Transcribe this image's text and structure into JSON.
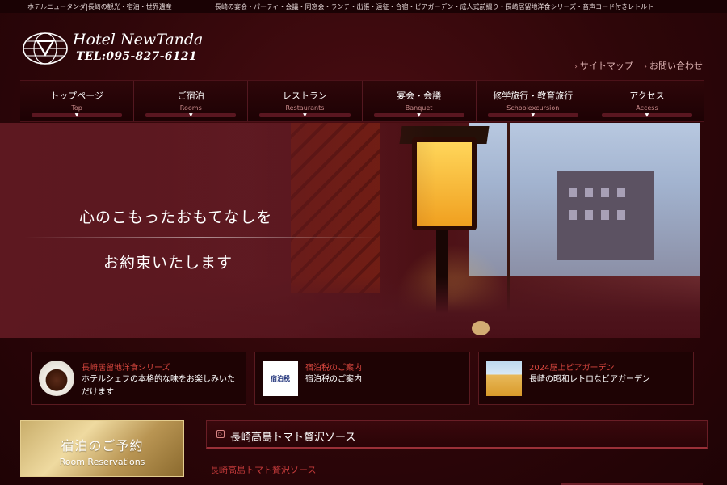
{
  "topbar": {
    "left": "ホテルニュータンダ|長崎の観光・宿泊・世界遺産",
    "right": "長崎の宴会・パーティ・会議・同窓会・ランチ・出張・遠征・合宿・ビアガーデン・成人式前撮り・長崎居留地洋食シリーズ・音声コード付きレトルト"
  },
  "logo": {
    "name": "Hotel NewTanda",
    "tel": "TEL:095-827-6121"
  },
  "utility": {
    "sitemap": "サイトマップ",
    "contact": "お問い合わせ"
  },
  "nav": [
    {
      "ja": "トップページ",
      "en": "Top"
    },
    {
      "ja": "ご宿泊",
      "en": "Rooms"
    },
    {
      "ja": "レストラン",
      "en": "Restaurants"
    },
    {
      "ja": "宴会・会議",
      "en": "Banquet"
    },
    {
      "ja": "修学旅行・教育旅行",
      "en": "Schoolexcursion"
    },
    {
      "ja": "アクセス",
      "en": "Access"
    }
  ],
  "hero": {
    "line1": "心のこもったおもてなしを",
    "line2": "お約束いたします"
  },
  "cards": [
    {
      "title": "長崎居留地洋食シリーズ",
      "desc": "ホテルシェフの本格的な味をお楽しみいただけます",
      "icon": "food-plate-icon"
    },
    {
      "title": "宿泊税のご案内",
      "desc": "宿泊税のご案内",
      "thumb_text": "宿泊税",
      "icon": "tax-label-icon"
    },
    {
      "title": "2024屋上ビアガーデン",
      "desc": "長崎の昭和レトロなビアガーデン",
      "icon": "beer-icon"
    }
  ],
  "reserve": {
    "ja": "宿泊のご予約",
    "en": "Room Reservations"
  },
  "news": {
    "heading": "長崎高島トマト贅沢ソース",
    "subheading": "長崎高島トマト贅沢ソース",
    "icon_glyph": "▷"
  },
  "colors": {
    "background": "#2e0609",
    "accent_red": "#d9473f",
    "gold": "#c9ae6b"
  }
}
